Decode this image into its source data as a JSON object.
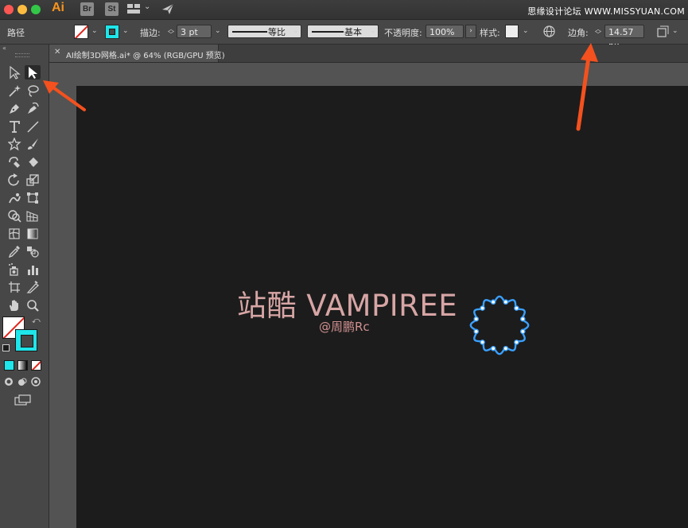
{
  "app": {
    "logo": "Ai",
    "bridge_label": "Br",
    "stock_label": "St",
    "watermark": "思缘设计论坛 WWW.MISSYUAN.COM"
  },
  "control_bar": {
    "selection_kind": "路径",
    "stroke_label": "描边:",
    "stroke_weight": "3 pt",
    "profile_label": "等比",
    "brush_label": "基本",
    "opacity_label": "不透明度:",
    "opacity_value": "100%",
    "style_label": "样式:",
    "corner_label": "边角:",
    "corner_value": "14.57 px",
    "fill_color": "#ffffff",
    "stroke_color": "#1ee6ea"
  },
  "document": {
    "tab_title": "AI绘制3D网格.ai* @ 64% (RGB/GPU 预览)"
  },
  "toolbox": {
    "tools": [
      "selection-tool-icon",
      "direct-selection-tool-icon",
      "magic-wand-tool-icon",
      "lasso-tool-icon",
      "pen-tool-icon",
      "curvature-tool-icon",
      "type-tool-icon",
      "line-segment-tool-icon",
      "star-tool-icon",
      "paintbrush-tool-icon",
      "shaper-tool-icon",
      "eraser-tool-icon",
      "rotate-tool-icon",
      "scale-tool-icon",
      "warp-tool-icon",
      "free-transform-tool-icon",
      "shape-builder-tool-icon",
      "perspective-grid-tool-icon",
      "mesh-tool-icon",
      "gradient-tool-icon",
      "eyedropper-tool-icon",
      "blend-tool-icon",
      "symbol-sprayer-tool-icon",
      "column-graph-tool-icon",
      "artboard-tool-icon",
      "slice-tool-icon",
      "hand-tool-icon",
      "zoom-tool-icon"
    ],
    "fill_color": "#ffffff",
    "stroke_color": "#1ee6ea"
  },
  "artwork": {
    "title": "站酷 VAMPIREE",
    "author": "@周鹏Rc",
    "title_color": "#d7a5a5",
    "shape_color": "#3aa0ff"
  }
}
